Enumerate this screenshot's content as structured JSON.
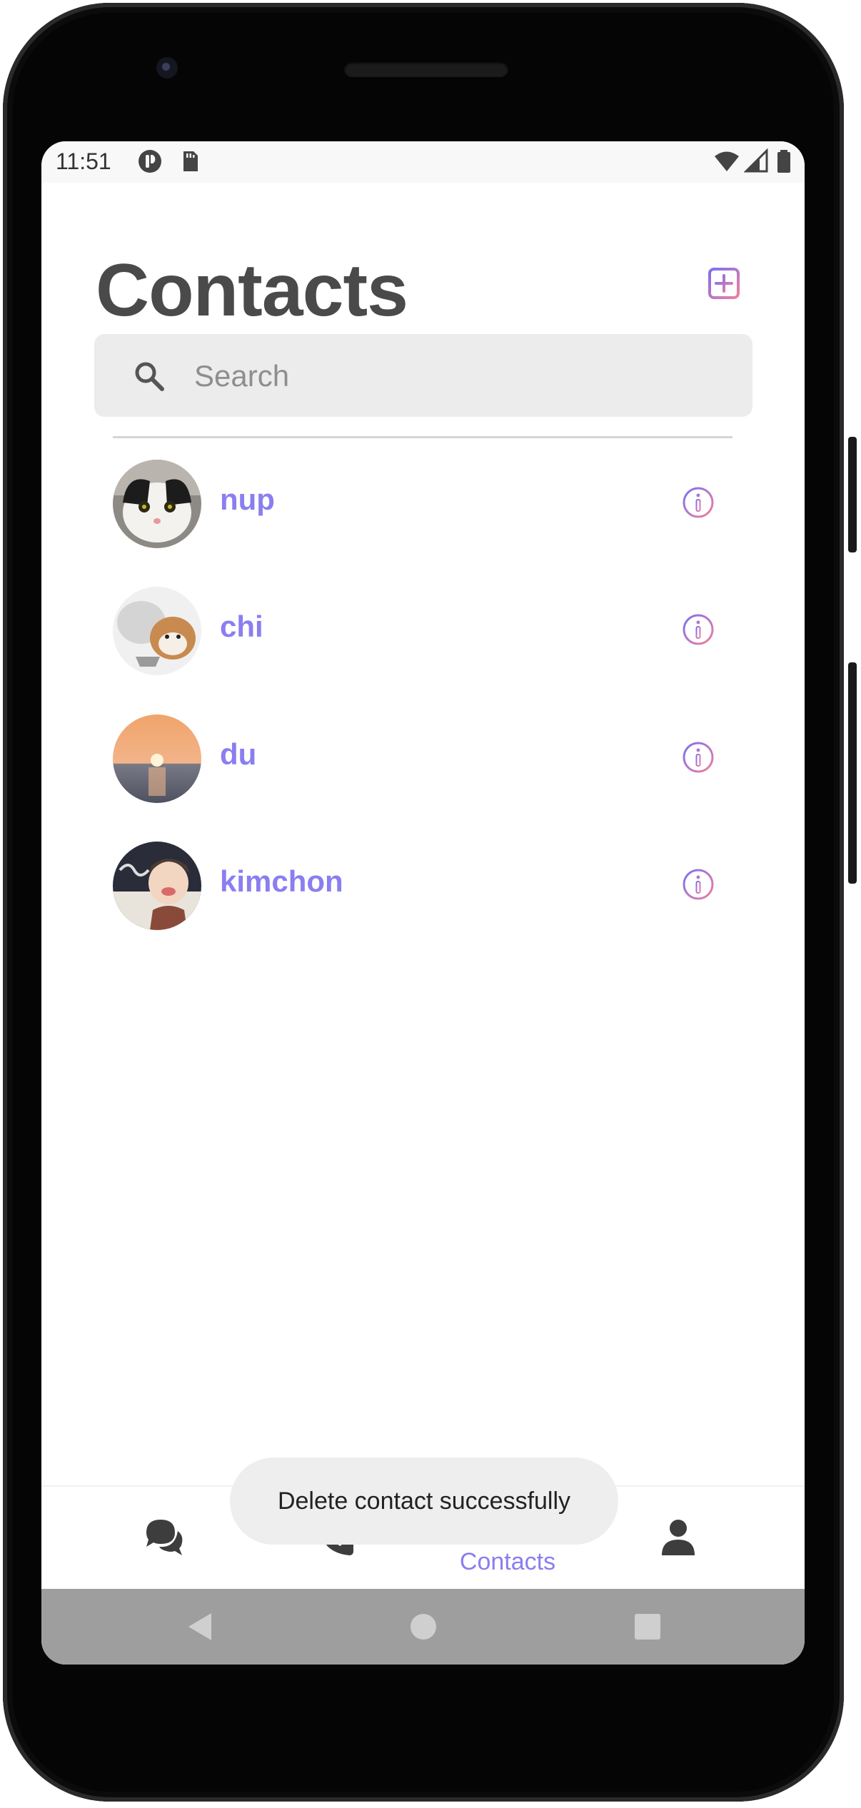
{
  "status_bar": {
    "time": "11:51"
  },
  "header": {
    "title": "Contacts"
  },
  "search": {
    "placeholder": "Search",
    "value": ""
  },
  "contacts": [
    {
      "name": "nup"
    },
    {
      "name": "chi"
    },
    {
      "name": "du"
    },
    {
      "name": "kimchon"
    }
  ],
  "toast": {
    "message": "Delete contact successfully"
  },
  "bottom_nav": {
    "items": [
      {
        "icon": "chat-bubbles-icon"
      },
      {
        "icon": "phone-icon"
      },
      {
        "icon": "contacts-icon",
        "label": "Contacts",
        "active": true
      },
      {
        "icon": "profile-icon"
      }
    ]
  },
  "colors": {
    "accent": "#8a7ef0",
    "title": "#4a4a4a",
    "gradient_start": "#7f6ff0",
    "gradient_end": "#f07f9f"
  }
}
